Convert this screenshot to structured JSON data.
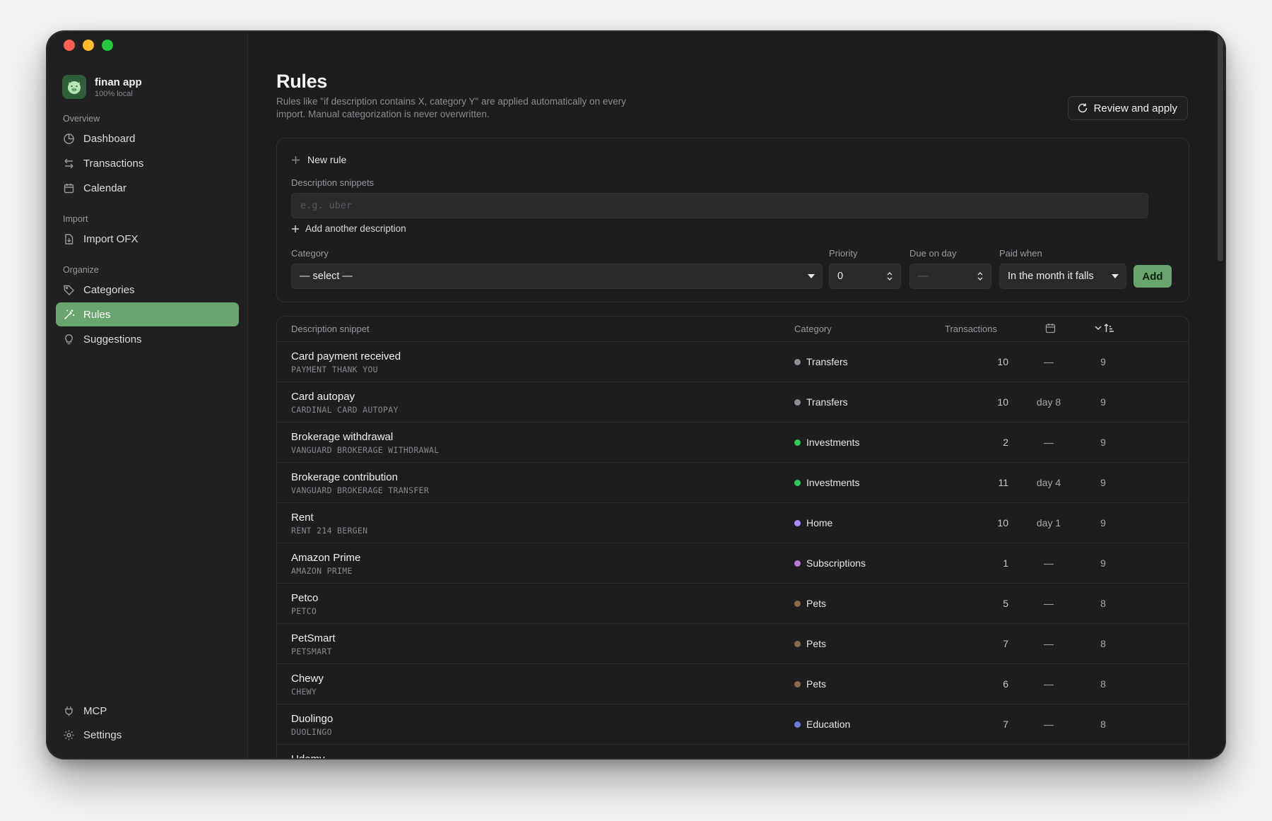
{
  "app": {
    "name": "finan app",
    "subtitle": "100% local"
  },
  "sidebar": {
    "sections": [
      {
        "label": "Overview"
      },
      {
        "label": "Import"
      },
      {
        "label": "Organize"
      }
    ],
    "items": [
      {
        "label": "Dashboard",
        "icon": "pie-chart-icon"
      },
      {
        "label": "Transactions",
        "icon": "arrows-swap-icon"
      },
      {
        "label": "Calendar",
        "icon": "calendar-icon"
      },
      {
        "label": "Import OFX",
        "icon": "file-import-icon"
      },
      {
        "label": "Categories",
        "icon": "tag-icon"
      },
      {
        "label": "Rules",
        "icon": "magic-wand-icon",
        "active": true
      },
      {
        "label": "Suggestions",
        "icon": "lightbulb-icon"
      }
    ],
    "footer": [
      {
        "label": "MCP",
        "icon": "plug-icon"
      },
      {
        "label": "Settings",
        "icon": "gear-icon"
      }
    ]
  },
  "page": {
    "title": "Rules",
    "description": "Rules like \"if description contains X, category Y\" are applied automatically on every import. Manual categorization is never overwritten.",
    "review_button": "Review and apply"
  },
  "new_rule": {
    "title": "New rule",
    "description_label": "Description snippets",
    "description_placeholder": "e.g. uber",
    "add_another": "Add another description",
    "category_label": "Category",
    "category_value": "— select —",
    "priority_label": "Priority",
    "priority_value": "0",
    "due_label": "Due on day",
    "due_value": "—",
    "paid_label": "Paid when",
    "paid_value": "In the month it falls",
    "add_button": "Add"
  },
  "table": {
    "headers": {
      "snippet": "Description snippet",
      "category": "Category",
      "transactions": "Transactions"
    },
    "rows": [
      {
        "name": "Card payment received",
        "snippet": "PAYMENT THANK YOU",
        "category": "Transfers",
        "color": "#8e8e93",
        "transactions": "10",
        "due": "—",
        "priority": "9"
      },
      {
        "name": "Card autopay",
        "snippet": "CARDINAL CARD AUTOPAY",
        "category": "Transfers",
        "color": "#8e8e93",
        "transactions": "10",
        "due": "day 8",
        "priority": "9"
      },
      {
        "name": "Brokerage withdrawal",
        "snippet": "VANGUARD BROKERAGE WITHDRAWAL",
        "category": "Investments",
        "color": "#34c759",
        "transactions": "2",
        "due": "—",
        "priority": "9"
      },
      {
        "name": "Brokerage contribution",
        "snippet": "VANGUARD BROKERAGE TRANSFER",
        "category": "Investments",
        "color": "#34c759",
        "transactions": "11",
        "due": "day 4",
        "priority": "9"
      },
      {
        "name": "Rent",
        "snippet": "RENT 214 BERGEN",
        "category": "Home",
        "color": "#a78bfa",
        "transactions": "10",
        "due": "day 1",
        "priority": "9"
      },
      {
        "name": "Amazon Prime",
        "snippet": "AMAZON PRIME",
        "category": "Subscriptions",
        "color": "#b57bd6",
        "transactions": "1",
        "due": "—",
        "priority": "9"
      },
      {
        "name": "Petco",
        "snippet": "PETCO",
        "category": "Pets",
        "color": "#8b6b4e",
        "transactions": "5",
        "due": "—",
        "priority": "8"
      },
      {
        "name": "PetSmart",
        "snippet": "PETSMART",
        "category": "Pets",
        "color": "#8b6b4e",
        "transactions": "7",
        "due": "—",
        "priority": "8"
      },
      {
        "name": "Chewy",
        "snippet": "CHEWY",
        "category": "Pets",
        "color": "#8b6b4e",
        "transactions": "6",
        "due": "—",
        "priority": "8"
      },
      {
        "name": "Duolingo",
        "snippet": "DUOLINGO",
        "category": "Education",
        "color": "#6b7fd7",
        "transactions": "7",
        "due": "—",
        "priority": "8"
      },
      {
        "name": "Udemy",
        "snippet": "",
        "category": "",
        "color": "#6b7fd7",
        "transactions": "",
        "due": "",
        "priority": ""
      }
    ]
  }
}
